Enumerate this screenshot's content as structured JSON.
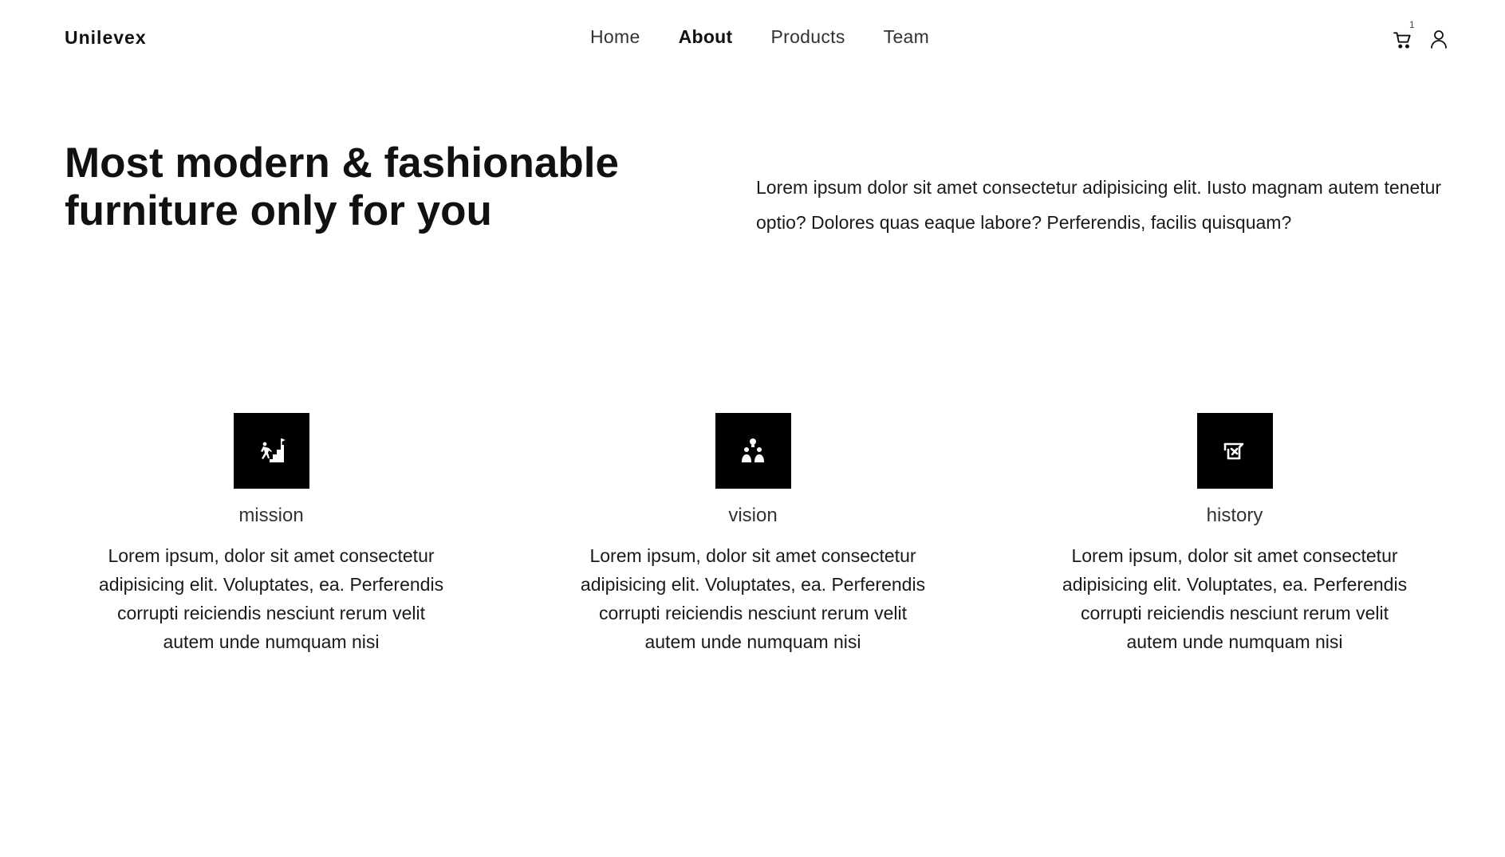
{
  "brand": "Unilevex",
  "nav": {
    "items": [
      {
        "label": "Home"
      },
      {
        "label": "About"
      },
      {
        "label": "Products"
      },
      {
        "label": "Team"
      }
    ]
  },
  "header": {
    "cart_count": "1",
    "cart_icon": "cart-icon",
    "user_icon": "user-icon"
  },
  "hero": {
    "title": "Most modern & fashionable furniture only for you",
    "text": "Lorem ipsum dolor sit amet consectetur adipisicing elit. Iusto magnam autem tenetur optio? Dolores quas eaque labore? Perferendis, facilis quisquam?"
  },
  "features": [
    {
      "icon": "mission-icon",
      "title": "mission",
      "text": "Lorem ipsum, dolor sit amet consectetur adipisicing elit. Voluptates, ea. Perferendis corrupti reiciendis nesciunt rerum velit autem unde numquam nisi"
    },
    {
      "icon": "vision-icon",
      "title": "vision",
      "text": "Lorem ipsum, dolor sit amet consectetur adipisicing elit. Voluptates, ea. Perferendis corrupti reiciendis nesciunt rerum velit autem unde numquam nisi"
    },
    {
      "icon": "history-icon",
      "title": "history",
      "text": "Lorem ipsum, dolor sit amet consectetur adipisicing elit. Voluptates, ea. Perferendis corrupti reiciendis nesciunt rerum velit autem unde numquam nisi"
    }
  ]
}
